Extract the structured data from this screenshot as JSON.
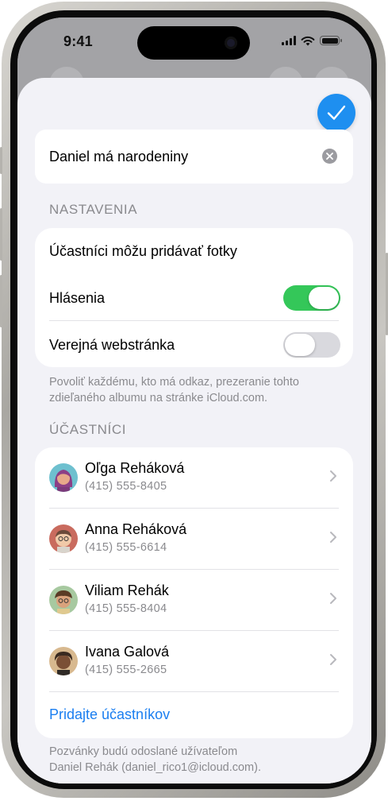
{
  "status_bar": {
    "time": "9:41"
  },
  "album": {
    "title": "Daniel má narodeniny"
  },
  "settings": {
    "header": "NASTAVENIA",
    "items": [
      {
        "label": "Účastníci môžu pridávať fotky"
      },
      {
        "label": "Hlásenia",
        "toggle": "on"
      },
      {
        "label": "Verejná webstránka",
        "toggle": "off"
      }
    ],
    "footnote": "Povoliť každému, kto má odkaz, prezeranie tohto zdieľaného albumu na stránke iCloud.com."
  },
  "participants": {
    "header": "ÚČASTNÍCI",
    "people": [
      {
        "name": "Oľga Reháková",
        "phone": "(415) 555-8405"
      },
      {
        "name": "Anna Reháková",
        "phone": "(415) 555-6614"
      },
      {
        "name": "Viliam Rehák",
        "phone": "(415) 555-8404"
      },
      {
        "name": "Ivana Galová",
        "phone": "(415) 555-2665"
      }
    ],
    "add_label": "Pridajte účastníkov",
    "invite_note_line1": "Pozvánky budú odoslané užívateľom",
    "invite_note_line2": "Daniel Rehák (daniel_rico1@icloud.com)."
  },
  "colors": {
    "accent": "#1a7ef0",
    "toggle_on": "#34c759",
    "done_button": "#1e8ff0"
  },
  "icons": [
    "checkmark-icon",
    "clear-icon",
    "chevron-right-icon",
    "wifi-icon",
    "signal-icon",
    "battery-icon"
  ]
}
